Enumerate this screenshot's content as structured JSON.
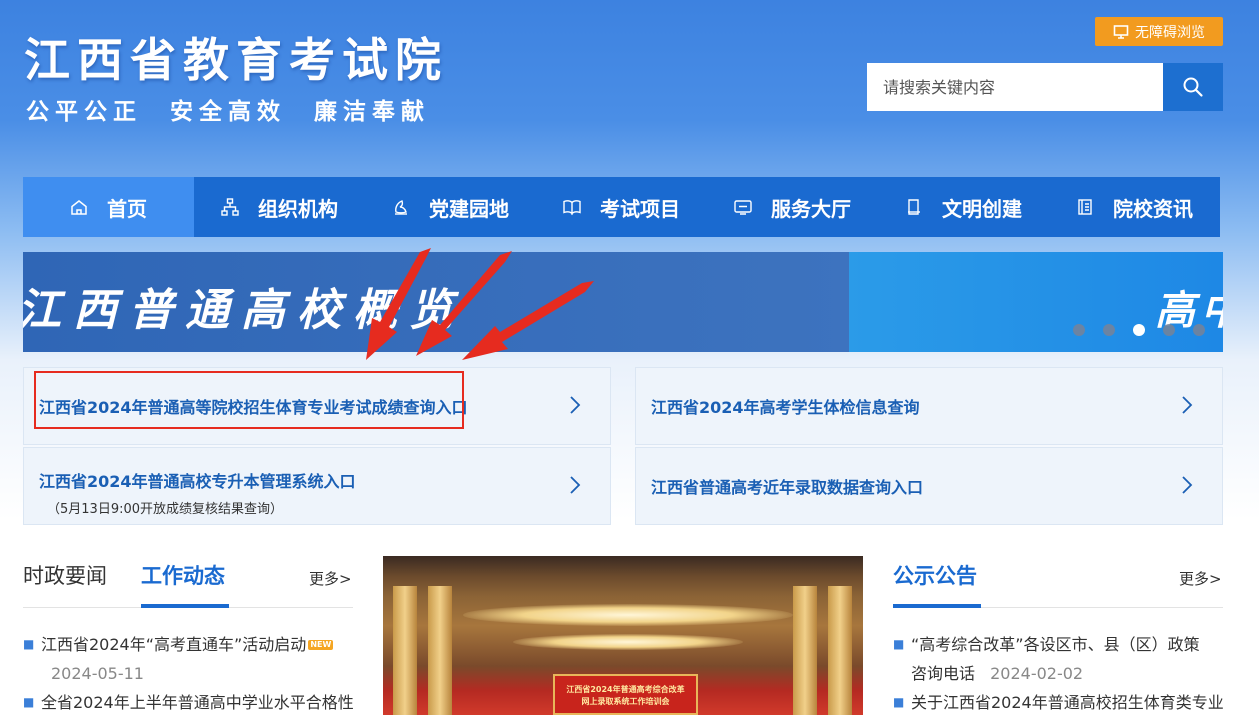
{
  "header": {
    "site_title": "江西省教育考试院",
    "slogan": "公平公正  安全高效  廉洁奉献",
    "accessibility_label": "无障碍浏览",
    "search_placeholder": "请搜索关键内容"
  },
  "nav": {
    "items": [
      {
        "label": "首页",
        "icon": "home-icon"
      },
      {
        "label": "组织机构",
        "icon": "org-chart-icon"
      },
      {
        "label": "党建园地",
        "icon": "party-icon"
      },
      {
        "label": "考试项目",
        "icon": "book-icon"
      },
      {
        "label": "服务大厅",
        "icon": "service-icon"
      },
      {
        "label": "文明创建",
        "icon": "document-icon"
      },
      {
        "label": "院校资讯",
        "icon": "news-icon"
      }
    ]
  },
  "banner": {
    "text_left": "江西普通高校概览",
    "text_right": "高中",
    "slide_count": 5,
    "active_slide": 3
  },
  "quick_links": [
    {
      "title": "江西省2024年普通高等院校招生体育专业考试成绩查询入口",
      "highlighted": true
    },
    {
      "title": "江西省2024年高考学生体检信息查询"
    },
    {
      "title": "江西省2024年普通高校专升本管理系统入口",
      "subtitle": "（5月13日9:00开放成绩复核结果查询）"
    },
    {
      "title": "江西省普通高考近年录取数据查询入口"
    }
  ],
  "news_left": {
    "tab_inactive": "时政要闻",
    "tab_active": "工作动态",
    "more": "更多>",
    "items": [
      {
        "title": "江西省2024年“高考直通车”活动启动",
        "badge": "NEW",
        "date": "2024-05-11"
      },
      {
        "title": "全省2024年上半年普通高中学业水平合格性"
      }
    ]
  },
  "photo": {
    "stage_line1": "江西省2024年普通高考综合改革",
    "stage_line2": "网上录取系统工作培训会"
  },
  "news_right": {
    "tab": "公示公告",
    "more": "更多>",
    "items": [
      {
        "title_line1": " “高考综合改革”各设区市、县（区）政策",
        "title_line2": "咨询电话",
        "date": "2024-02-02"
      },
      {
        "title_line1": "关于江西省2024年普通高校招生体育类专业"
      }
    ]
  },
  "colors": {
    "nav_bg": "#1a6ad0",
    "nav_active": "#3f8ef0",
    "accent_orange": "#f29b1f",
    "link_blue": "#1a5fb4",
    "highlight_red": "#e62b1f"
  }
}
